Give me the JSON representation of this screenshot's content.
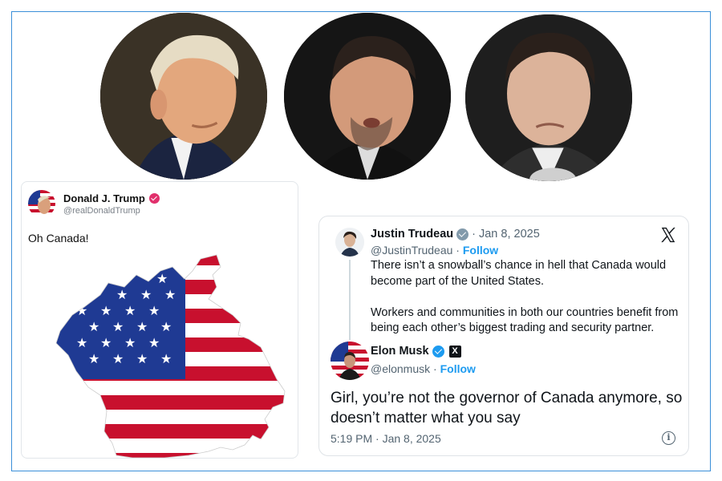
{
  "trump_post": {
    "name": "Donald J. Trump",
    "handle": "@realDonaldTrump",
    "text": "Oh Canada!",
    "badge_color": "#e1306c"
  },
  "tweet": {
    "trudeau": {
      "name": "Justin Trudeau",
      "date": "· Jan 8, 2025",
      "handle": "@JustinTrudeau",
      "separator": " · ",
      "follow": "Follow",
      "paragraph1": "There isn’t a snowball’s chance in hell that Canada would become part of the United States.",
      "paragraph2": "Workers and communities in both our countries benefit from being each other’s biggest trading and security partner."
    },
    "musk": {
      "name": "Elon Musk",
      "handle": "@elonmusk",
      "separator": " · ",
      "follow": "Follow",
      "reply": "Girl, you’re not the governor of Canada anymore, so doesn’t matter what you say",
      "timestamp": "5:19 PM · Jan 8, 2025",
      "affiliate_badge": "X"
    },
    "info_icon": "i"
  },
  "colors": {
    "frame": "#3b8fd9",
    "twitter_blue": "#1d9bf0",
    "flag_red": "#c8102e",
    "flag_blue": "#1f3a93"
  },
  "icons": [
    "x-logo-icon",
    "verified-badge-icon",
    "info-icon",
    "affiliate-x-icon"
  ]
}
